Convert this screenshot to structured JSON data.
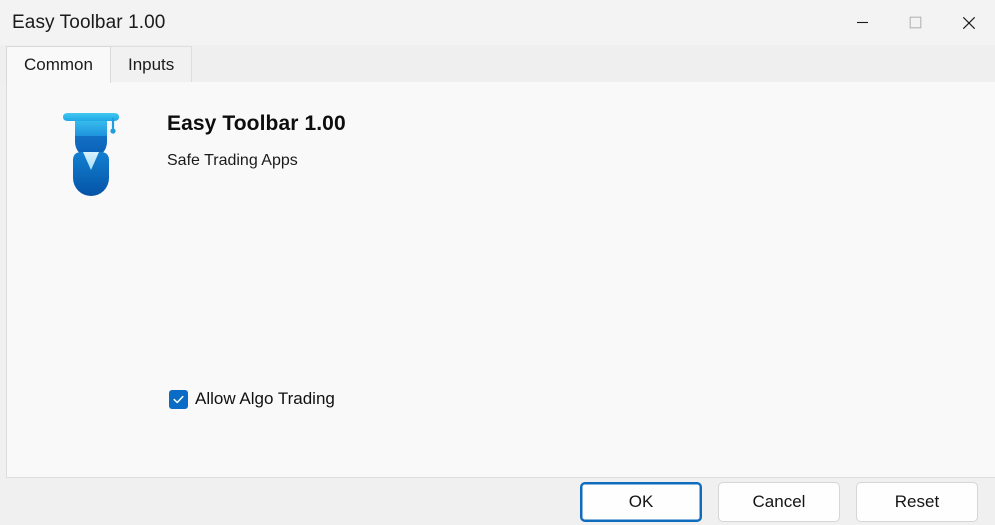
{
  "window": {
    "title": "Easy Toolbar 1.00",
    "controls": [
      {
        "name": "minimize",
        "glyph": "minimize-icon",
        "enabled": true
      },
      {
        "name": "maximize",
        "glyph": "maximize-icon",
        "enabled": false
      },
      {
        "name": "close",
        "glyph": "close-icon",
        "enabled": true
      }
    ]
  },
  "tabs": [
    {
      "label": "Common",
      "active": true
    },
    {
      "label": "Inputs",
      "active": false
    }
  ],
  "app": {
    "logo_icon": "graduate-avatar-icon",
    "name": "Easy Toolbar 1.00",
    "vendor": "Safe Trading Apps"
  },
  "options": {
    "allow_algo_trading": {
      "label": "Allow Algo Trading",
      "checked": true
    }
  },
  "footer": {
    "buttons": [
      {
        "label": "OK",
        "focused": true
      },
      {
        "label": "Cancel",
        "focused": false
      },
      {
        "label": "Reset",
        "focused": false
      }
    ]
  },
  "colors": {
    "accent": "#0a6cc5",
    "focus_ring": "#0f6cbd",
    "titlebar_bg": "#f3f3f3",
    "tabstrip_bg": "#efefef",
    "panel_bg": "#f9f9f9",
    "footer_bg": "#f0f0f0",
    "logo_cap_light": "#35c0ef",
    "logo_cap_dark": "#1b86d6",
    "logo_body": "#0a66c2",
    "logo_collar": "#bfe9fb"
  }
}
